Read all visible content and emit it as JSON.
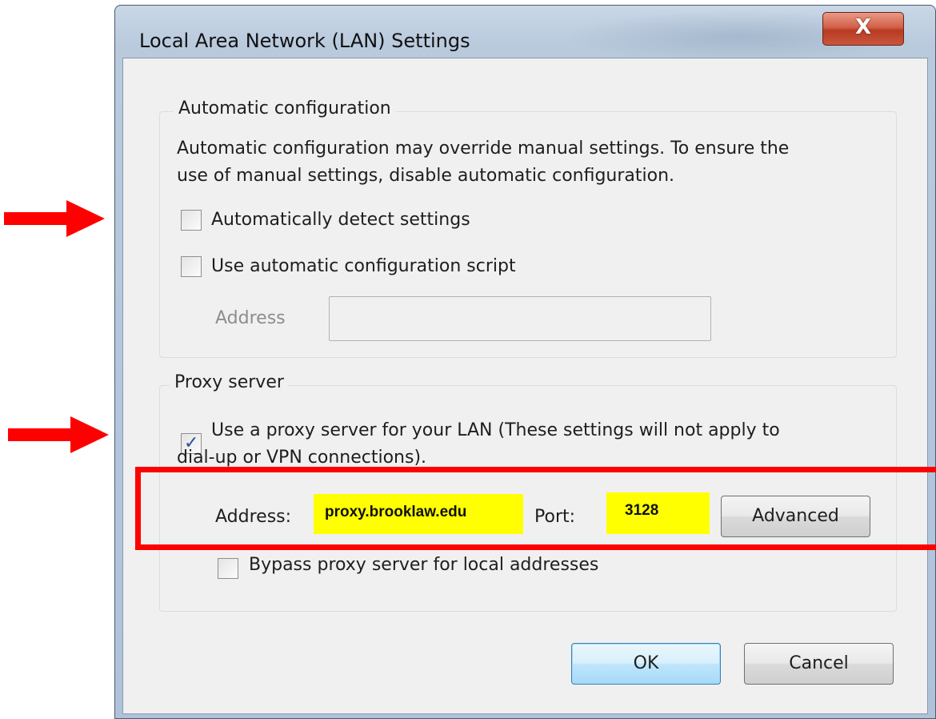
{
  "window": {
    "title": "Local Area Network (LAN) Settings",
    "close_glyph": "X"
  },
  "automatic_configuration": {
    "legend": "Automatic configuration",
    "description_line1": "Automatic configuration may override manual settings.  To ensure the",
    "description_line2": "use of manual settings, disable automatic configuration.",
    "detect_settings": {
      "label": "Automatically detect settings",
      "checked": false
    },
    "config_script": {
      "label": "Use automatic configuration script",
      "checked": false
    },
    "address_label": "Address",
    "address_value": ""
  },
  "proxy_server": {
    "legend": "Proxy server",
    "use_proxy": {
      "label_line1": "Use a proxy server for your LAN (These settings will not apply to",
      "label_line2": "dial-up or VPN connections).",
      "checked": true
    },
    "address_label": "Address:",
    "address_value": "proxy.brooklaw.edu",
    "port_label": "Port:",
    "port_value": "3128",
    "advanced_label": "Advanced",
    "bypass": {
      "label": "Bypass proxy server for local addresses",
      "checked": false
    }
  },
  "buttons": {
    "ok": "OK",
    "cancel": "Cancel"
  },
  "colors": {
    "annotation": "#ff0000",
    "highlight": "#ffff00"
  }
}
